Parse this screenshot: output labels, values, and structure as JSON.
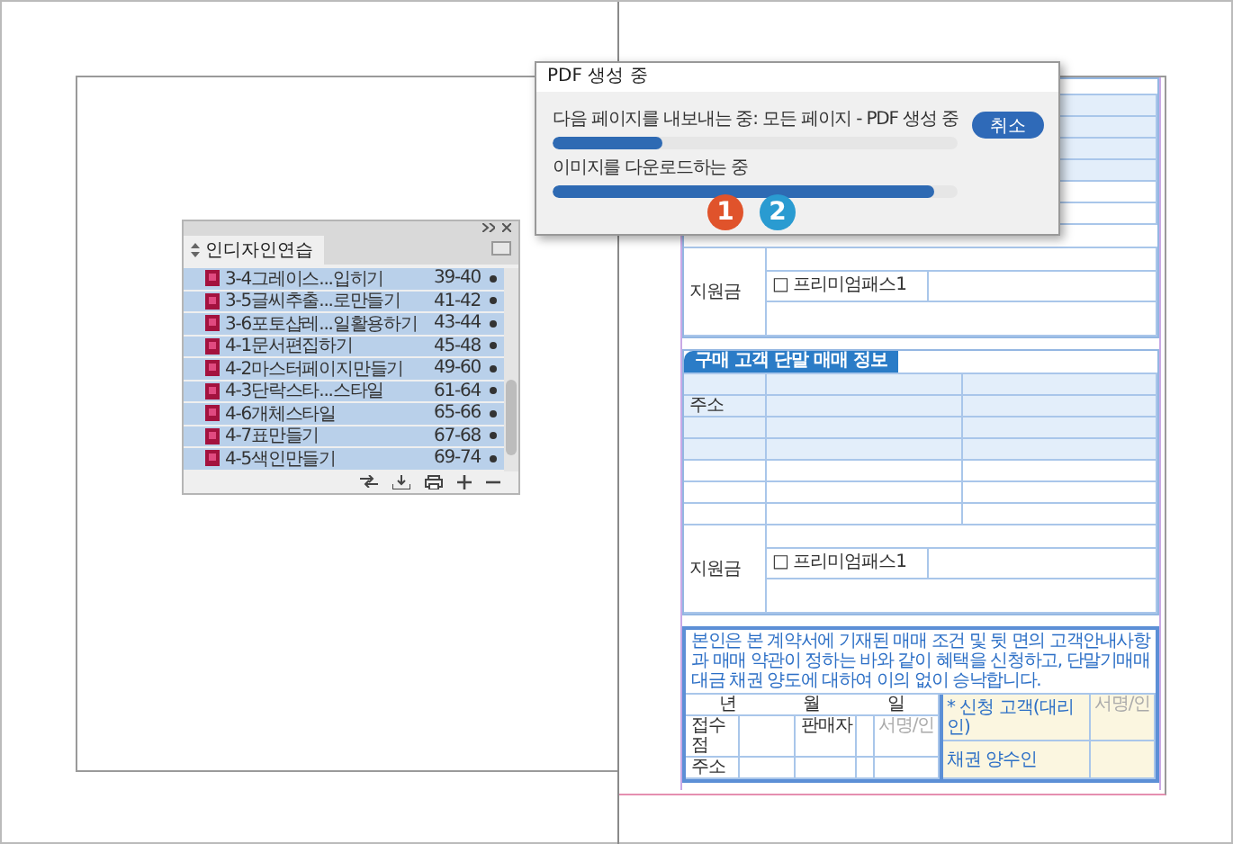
{
  "dialog": {
    "title": "PDF 생성 중",
    "tasks": [
      {
        "label": "다음 페이지를 내보내는 중: 모든 페이지 - PDF 생성 중",
        "level": 0.27
      },
      {
        "label": "이미지를 다운로드하는 중",
        "level": 0.94
      }
    ],
    "cancel_button": "취소"
  },
  "step_badges": [
    {
      "label": "1",
      "color": "#e0532b"
    },
    {
      "label": "2",
      "color": "#2a9bd1"
    }
  ],
  "book_panel": {
    "title": "인디자인연습",
    "documents": [
      {
        "name": "3-4그레이스...입히기",
        "pages": "39-40",
        "selected": true
      },
      {
        "name": "3-5글씨추출...로만들기",
        "pages": "41-42",
        "selected": true
      },
      {
        "name": "3-6포토샵레...일활용하기",
        "pages": "43-44",
        "selected": true
      },
      {
        "name": "4-1문서편집하기",
        "pages": "45-48",
        "selected": true
      },
      {
        "name": "4-2마스터페이지만들기",
        "pages": "49-60",
        "selected": true
      },
      {
        "name": "4-3단락스타...스타일",
        "pages": "61-64",
        "selected": true
      },
      {
        "name": "4-6개체스타일",
        "pages": "65-66",
        "selected": true
      },
      {
        "name": "4-7표만들기",
        "pages": "67-68",
        "selected": true
      },
      {
        "name": "4-5색인만들기",
        "pages": "69-74",
        "selected": true
      }
    ]
  },
  "form": {
    "upper_section": {
      "support_label": "지원금",
      "plan_checkbox": "□ 프리미엄패스1"
    },
    "customer_section": {
      "title": "구매 고객 단말 매매 정보",
      "address_label": "주소",
      "support_label": "지원금",
      "plan_checkbox": "□ 프리미엄패스1"
    },
    "agreement": {
      "text": "본인은 본 계약서에 기재된 매매 조건 및 뒷 면의 고객안내사항과 매매 약관이 정하는 바와 같이 혜택을 신청하고, 단말기매매대금 채권 양도에 대하여 이의 없이 승낙합니다.",
      "date_labels": [
        "년",
        "월",
        "일"
      ],
      "store_label": "접수점",
      "seller_label": "판매자",
      "seller_signature": "서명/인",
      "address_label": "주소",
      "applicant_label": "* 신청 고객(대리인)",
      "applicant_signature": "서명/인",
      "assignee_label": "채권 양수인"
    }
  }
}
